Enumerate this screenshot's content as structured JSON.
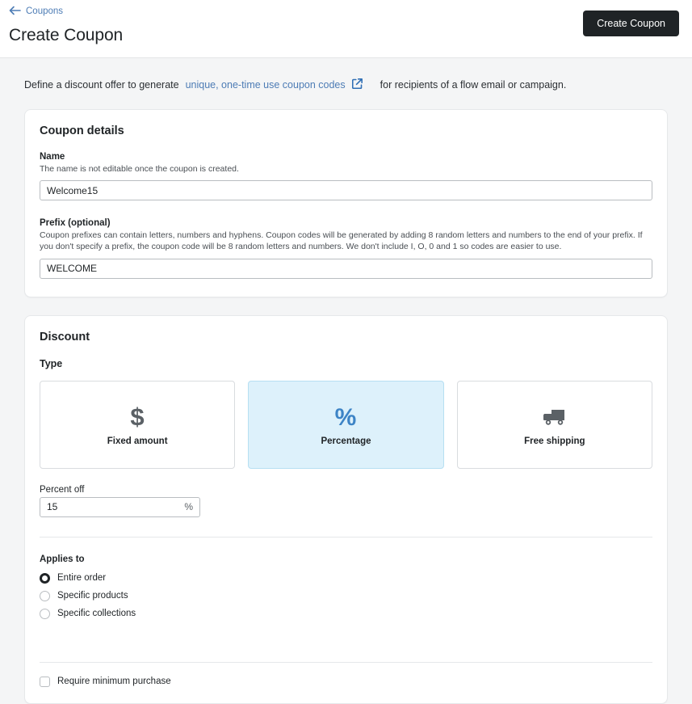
{
  "header": {
    "back_link": "Coupons",
    "back_icon": "arrow-left-icon",
    "title": "Create Coupon",
    "primary_button": "Create Coupon"
  },
  "intro": {
    "prefix_text": "Define a discount offer to generate",
    "link_text": "unique, one-time use coupon codes",
    "link_icon": "external-link-icon",
    "suffix_text": "for recipients of a flow email or campaign."
  },
  "coupon_details": {
    "title": "Coupon details",
    "name": {
      "label": "Name",
      "help": "The name is not editable once the coupon is created.",
      "value": "Welcome15"
    },
    "prefix": {
      "label": "Prefix (optional)",
      "help": "Coupon prefixes can contain letters, numbers and hyphens. Coupon codes will be generated by adding 8 random letters and numbers to the end of your prefix. If you don't specify a prefix, the coupon code will be 8 random letters and numbers. We don't include I, O, 0 and 1 so codes are easier to use.",
      "value": "WELCOME"
    }
  },
  "discount": {
    "title": "Discount",
    "type_label": "Type",
    "types": [
      {
        "label": "Fixed amount",
        "icon": "dollar-sign-icon",
        "selected": false
      },
      {
        "label": "Percentage",
        "icon": "percent-icon",
        "selected": true
      },
      {
        "label": "Free shipping",
        "icon": "truck-icon",
        "selected": false
      }
    ],
    "percent_off": {
      "label": "Percent off",
      "value": "15",
      "suffix": "%"
    },
    "applies_to": {
      "label": "Applies to",
      "options": [
        {
          "label": "Entire order",
          "selected": true
        },
        {
          "label": "Specific products",
          "selected": false
        },
        {
          "label": "Specific collections",
          "selected": false
        }
      ]
    },
    "minimum_purchase": {
      "label": "Require minimum purchase",
      "checked": false
    }
  },
  "colors": {
    "accent_link": "#4d7cb5",
    "selected_card_bg": "#ddf1fb",
    "selected_card_border": "#b6dff2",
    "percent_icon": "#3d84c6",
    "page_bg": "#f4f5f6",
    "primary_button_bg": "#1f2326"
  }
}
